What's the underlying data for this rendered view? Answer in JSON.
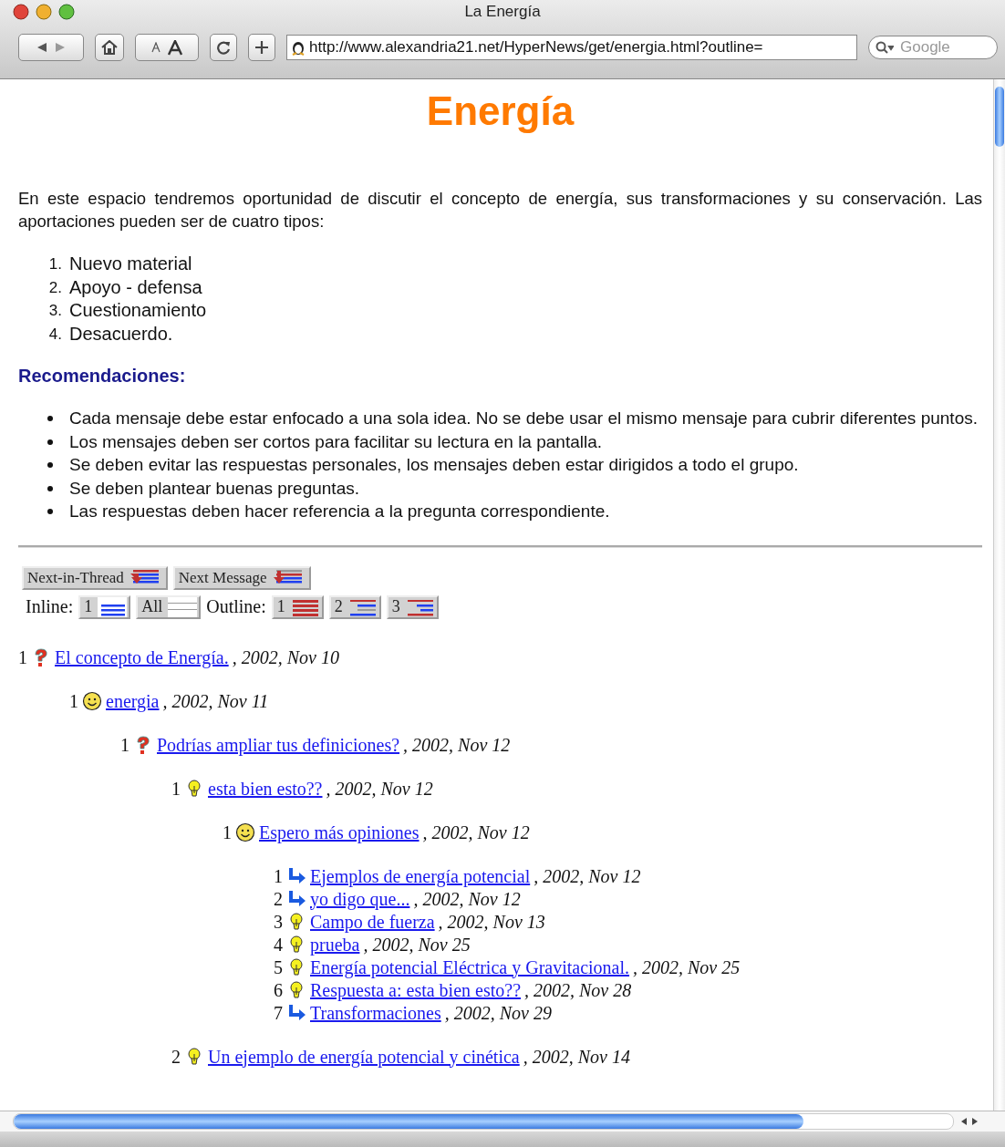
{
  "window": {
    "title": "La Energía"
  },
  "toolbar": {
    "url": "http://www.alexandria21.net/HyperNews/get/energia.html?outline=",
    "search_placeholder": "Google"
  },
  "heading": "Energía",
  "intro": "En este espacio tendremos oportunidad de discutir el concepto de energía, sus transformaciones y su conservación. Las aportaciones pueden ser de cuatro tipos:",
  "types": [
    {
      "number": "1.",
      "text": "Nuevo material"
    },
    {
      "number": "2.",
      "text": "Apoyo - defensa"
    },
    {
      "number": "3.",
      "text": "Cuestionamiento"
    },
    {
      "number": "4.",
      "text": "Desacuerdo."
    }
  ],
  "recommendations_heading": "Recomendaciones:",
  "recommendations": [
    "Cada mensaje debe estar enfocado a una sola idea. No se debe usar el mismo mensaje para cubrir diferentes puntos.",
    "Los mensajes deben ser cortos para facilitar su lectura en la pantalla.",
    "Se deben evitar las respuestas personales, los mensajes deben estar dirigidos a todo el grupo.",
    "Se deben plantear buenas preguntas.",
    "Las respuestas deben hacer referencia a la pregunta correspondiente."
  ],
  "nav_buttons": [
    {
      "label": "Next-in-Thread",
      "kind": "thread"
    },
    {
      "label": "Next Message",
      "kind": "message"
    }
  ],
  "inline": {
    "label": "Inline:",
    "buttons": [
      {
        "label": "1",
        "kind": "inline-one"
      },
      {
        "label": "All",
        "kind": "inline-all"
      }
    ]
  },
  "outline": {
    "label": "Outline:",
    "buttons": [
      {
        "label": "1",
        "kind": "outline-one"
      },
      {
        "label": "2",
        "kind": "outline-two"
      },
      {
        "label": "3",
        "kind": "outline-three"
      }
    ]
  },
  "thread": [
    {
      "number": "1",
      "kind": "question",
      "title": "El concepto de Energía.",
      "date": ", 2002, Nov 10",
      "children": [
        {
          "number": "1",
          "kind": "smile",
          "title": "energia",
          "date": ", 2002, Nov 11",
          "children": [
            {
              "number": "1",
              "kind": "question",
              "title": "Podrías ampliar tus definiciones?",
              "date": ", 2002, Nov 12",
              "children": [
                {
                  "number": "1",
                  "kind": "idea",
                  "title": "esta bien esto??",
                  "date": ", 2002, Nov 12",
                  "children": [
                    {
                      "number": "1",
                      "kind": "smile",
                      "title": "Espero más opiniones",
                      "date": ", 2002, Nov 12",
                      "children": [
                        {
                          "number": "1",
                          "kind": "reply",
                          "title": "Ejemplos de energía potencial",
                          "date": ", 2002, Nov 12"
                        },
                        {
                          "number": "2",
                          "kind": "reply",
                          "title": "yo digo que...",
                          "date": ", 2002, Nov 12"
                        },
                        {
                          "number": "3",
                          "kind": "idea",
                          "title": "Campo de fuerza",
                          "date": ", 2002, Nov 13"
                        },
                        {
                          "number": "4",
                          "kind": "idea",
                          "title": "prueba",
                          "date": ", 2002, Nov 25"
                        },
                        {
                          "number": "5",
                          "kind": "idea",
                          "title": "Energía potencial Eléctrica y Gravitacional.",
                          "date": ", 2002, Nov 25"
                        },
                        {
                          "number": "6",
                          "kind": "idea",
                          "title": "Respuesta a: esta bien esto??",
                          "date": ", 2002, Nov 28"
                        },
                        {
                          "number": "7",
                          "kind": "reply",
                          "title": "Transformaciones",
                          "date": ", 2002, Nov 29"
                        }
                      ]
                    }
                  ]
                },
                {
                  "number": "2",
                  "kind": "idea",
                  "title": "Un ejemplo de energía potencial y cinética",
                  "date": ", 2002, Nov 14"
                }
              ]
            }
          ]
        }
      ]
    }
  ]
}
